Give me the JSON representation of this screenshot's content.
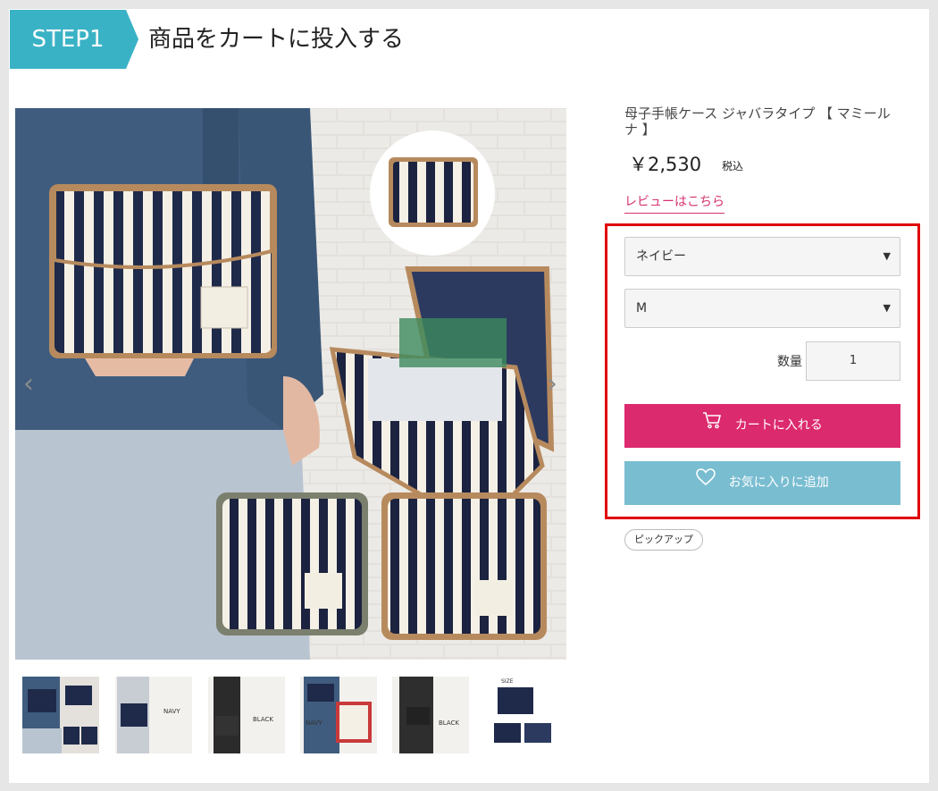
{
  "header": {
    "step_label": "STEP1",
    "title": "商品をカートに投入する"
  },
  "product": {
    "name": "母子手帳ケース ジャバラタイプ 【 マミールナ 】",
    "price": "￥2,530",
    "tax_label": "税込",
    "review_link": "レビューはこちら"
  },
  "options": {
    "color_value": "ネイビー",
    "size_value": "M",
    "quantity_label": "数量",
    "quantity_value": "1"
  },
  "buttons": {
    "add_to_cart": "カートに入れる",
    "add_to_favorites": "お気に入りに追加"
  },
  "tags": [
    "ピックアップ"
  ],
  "gallery": {
    "thumbnail_texts": [
      "",
      "NAVY",
      "BLACK",
      "NAVY",
      "BLACK",
      "SIZE"
    ]
  },
  "colors": {
    "step_badge": "#3ab2c6",
    "cart_button": "#dc2a6e",
    "favorite_button": "#79bdd1",
    "highlight_box": "#e00000",
    "review_link": "#d63372"
  }
}
